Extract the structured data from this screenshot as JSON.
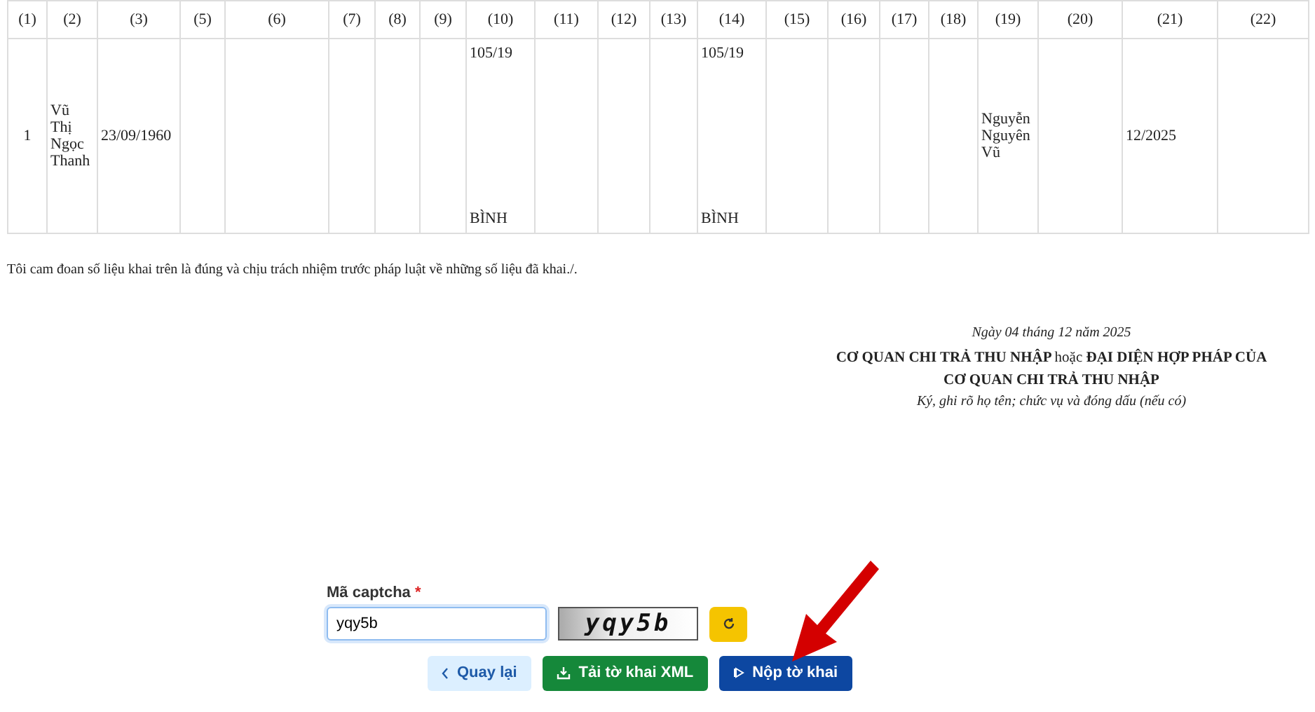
{
  "table": {
    "columns": [
      "(1)",
      "(2)",
      "(3)",
      "(5)",
      "(6)",
      "(7)",
      "(8)",
      "(9)",
      "(10)",
      "(11)",
      "(12)",
      "(13)",
      "(14)",
      "(15)",
      "(16)",
      "(17)",
      "(18)",
      "(19)",
      "(20)",
      "(21)",
      "(22)"
    ],
    "rows": [
      {
        "cells": [
          {
            "kind": "middle",
            "text": "1"
          },
          {
            "kind": "middle",
            "text": "Vũ Thị Ngọc Thanh"
          },
          {
            "kind": "middle",
            "text": "23/09/1960"
          },
          {
            "kind": "empty"
          },
          {
            "kind": "empty"
          },
          {
            "kind": "empty"
          },
          {
            "kind": "empty"
          },
          {
            "kind": "empty"
          },
          {
            "kind": "split",
            "top": "105/19",
            "bottom": "BÌNH"
          },
          {
            "kind": "empty"
          },
          {
            "kind": "empty"
          },
          {
            "kind": "empty"
          },
          {
            "kind": "split",
            "top": "105/19",
            "bottom": "BÌNH"
          },
          {
            "kind": "empty"
          },
          {
            "kind": "empty"
          },
          {
            "kind": "empty"
          },
          {
            "kind": "empty"
          },
          {
            "kind": "middle",
            "text": "Nguyễn Nguyên Vũ"
          },
          {
            "kind": "empty"
          },
          {
            "kind": "middle",
            "text": "12/2025"
          },
          {
            "kind": "empty"
          }
        ]
      }
    ]
  },
  "declaration": "Tôi cam đoan số liệu khai trên là đúng và chịu trách nhiệm trước pháp luật về những số liệu đã khai./.",
  "signature": {
    "date": "Ngày 04 tháng 12 năm 2025",
    "title": "CƠ QUAN CHI TRẢ THU NHẬP **hoặc** ĐẠI DIỆN HỢP PHÁP CỦA CƠ QUAN CHI TRẢ THU NHẬP",
    "note": "Ký, ghi rõ họ tên; chức vụ và đóng dấu (nếu có)"
  },
  "captcha": {
    "label": "Mã captcha",
    "required_mark": "*",
    "value": "yqy5b",
    "image_text": "yqy5b"
  },
  "buttons": [
    {
      "kind": "back",
      "label": "Quay lại"
    },
    {
      "kind": "download",
      "label": "Tải tờ khai XML"
    },
    {
      "kind": "submit",
      "label": "Nộp tờ khai"
    }
  ]
}
